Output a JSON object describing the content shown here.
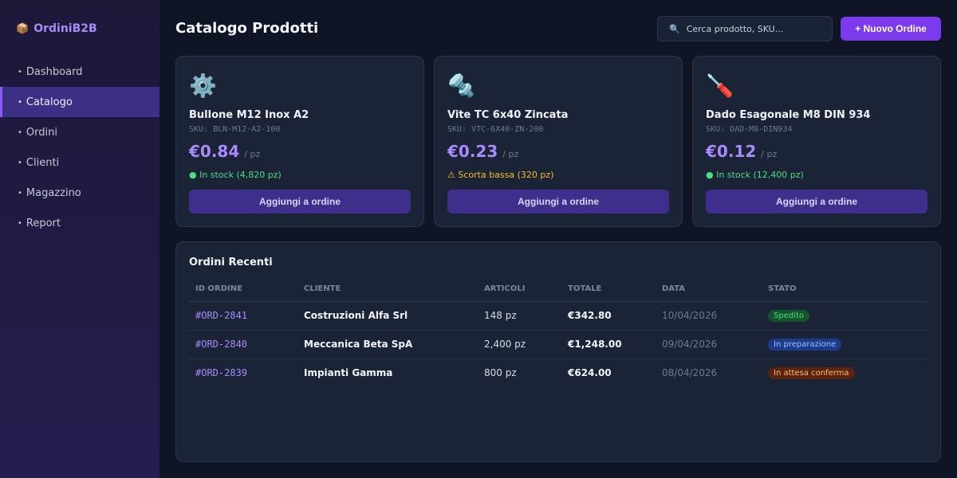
{
  "brand": {
    "logo_icon": "📦",
    "name": "OrdiniB2B"
  },
  "nav": [
    {
      "label": "Dashboard",
      "active": false
    },
    {
      "label": "Catalogo",
      "active": true
    },
    {
      "label": "Ordini",
      "active": false
    },
    {
      "label": "Clienti",
      "active": false
    },
    {
      "label": "Magazzino",
      "active": false
    },
    {
      "label": "Report",
      "active": false
    }
  ],
  "header": {
    "title": "Catalogo Prodotti",
    "search_placeholder": "Cerca prodotto, SKU...",
    "search_icon": "search-icon",
    "new_order_label": "+ Nuovo Ordine"
  },
  "products": [
    {
      "icon": "⚙️",
      "icon_name": "gear-icon",
      "name": "Bullone M12 Inox A2",
      "sku": "SKU: BLN-M12-A2-100",
      "price": "€0.84",
      "unit": "/ pz",
      "stock": "● In stock (4,820 pz)",
      "stock_status": "ok",
      "add_label": "Aggiungi a ordine"
    },
    {
      "icon": "🔩",
      "icon_name": "screw-icon",
      "name": "Vite TC 6x40 Zincata",
      "sku": "SKU: VTC-6X40-ZN-200",
      "price": "€0.23",
      "unit": "/ pz",
      "stock": "⚠ Scorta bassa (320 pz)",
      "stock_status": "low",
      "add_label": "Aggiungi a ordine"
    },
    {
      "icon": "🪛",
      "icon_name": "screwdriver-icon",
      "name": "Dado Esagonale M8 DIN 934",
      "sku": "SKU: DAD-M8-DIN934",
      "price": "€0.12",
      "unit": "/ pz",
      "stock": "● In stock (12,400 pz)",
      "stock_status": "ok",
      "add_label": "Aggiungi a ordine"
    }
  ],
  "orders": {
    "title": "Ordini Recenti",
    "columns": [
      "ID ORDINE",
      "CLIENTE",
      "ARTICOLI",
      "TOTALE",
      "DATA",
      "STATO"
    ],
    "rows": [
      {
        "id": "#ORD-2841",
        "client": "Costruzioni Alfa Srl",
        "items": "148 pz",
        "total": "€342.80",
        "date": "10/04/2026",
        "status": "Spedito",
        "status_kind": "shipped"
      },
      {
        "id": "#ORD-2840",
        "client": "Meccanica Beta SpA",
        "items": "2,400 pz",
        "total": "€1,248.00",
        "date": "09/04/2026",
        "status": "In preparazione",
        "status_kind": "prep"
      },
      {
        "id": "#ORD-2839",
        "client": "Impianti Gamma",
        "items": "800 pz",
        "total": "€624.00",
        "date": "08/04/2026",
        "status": "In attesa conferma",
        "status_kind": "wait"
      }
    ]
  },
  "colors": {
    "accent": "#7c3aed",
    "accent_light": "#a78bfa",
    "background": "#0f1524",
    "card": "#1b2436"
  }
}
